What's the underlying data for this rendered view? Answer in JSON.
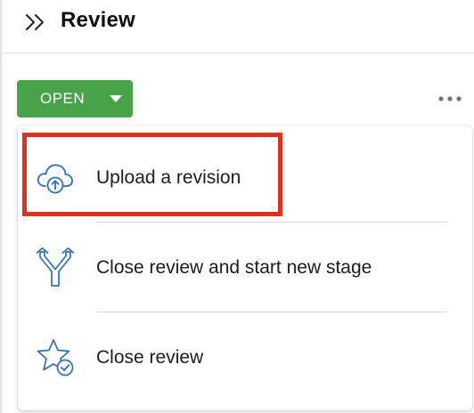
{
  "header": {
    "title": "Review",
    "collapse_icon": "double-chevron-right-icon"
  },
  "status": {
    "label": "OPEN",
    "color": "#48a248",
    "caret_icon": "caret-down-icon"
  },
  "more_icon": "ellipsis-horizontal-icon",
  "menu": {
    "items": [
      {
        "label": "Upload a revision",
        "icon": "cloud-upload-icon"
      },
      {
        "label": "Close review and start new stage",
        "icon": "merge-arrows-icon"
      },
      {
        "label": "Close review",
        "icon": "star-check-icon"
      }
    ]
  },
  "highlight": {
    "color": "#e0311e",
    "target": "Upload a revision"
  },
  "accent_icon_color": "#2f6fb8"
}
